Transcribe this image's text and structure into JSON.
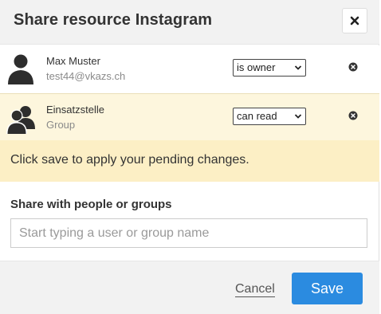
{
  "dialog": {
    "title": "Share resource Instagram"
  },
  "members": [
    {
      "name": "Max Muster",
      "subtitle": "test44@vkazs.ch",
      "avatar_icon": "user-silhouette-icon",
      "permission": "is owner"
    },
    {
      "name": "Einsatzstelle",
      "subtitle": "Group",
      "avatar_icon": "group-silhouette-icon",
      "permission": "can read"
    }
  ],
  "notice": {
    "text": "Click save to apply your pending changes."
  },
  "share": {
    "label": "Share with people or groups",
    "placeholder": "Start typing a user or group name",
    "value": ""
  },
  "footer": {
    "cancel_label": "Cancel",
    "save_label": "Save"
  },
  "colors": {
    "accent": "#2b8be0",
    "notice_bg": "#fcefc5",
    "highlight_row_bg": "#fdf6dd",
    "header_bg": "#f2f2f2"
  }
}
